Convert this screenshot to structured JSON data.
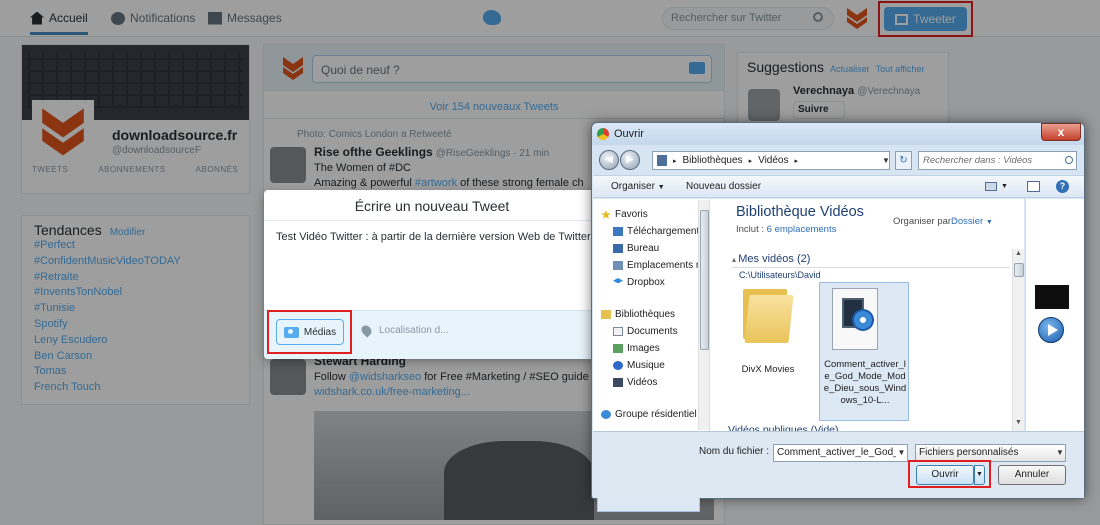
{
  "twitter": {
    "nav": {
      "home": "Accueil",
      "notifications": "Notifications",
      "messages": "Messages"
    },
    "search_placeholder": "Rechercher sur Twitter",
    "tweet_button": "Tweeter",
    "profile": {
      "name": "downloadsource.fr",
      "handle": "@downloadsourceF",
      "stats": [
        "TWEETS",
        "ABONNEMENTS",
        "ABONNÉS"
      ]
    },
    "trends": {
      "title": "Tendances",
      "edit": "Modifier",
      "items": [
        "#Perfect",
        "#ConfidentMusicVideoTODAY",
        "#Retraite",
        "#InventsTonNobel",
        "#Tunisie",
        "Spotify",
        "Leny Escudero",
        "Ben Carson",
        "Tomas",
        "French Touch"
      ]
    },
    "compose_placeholder": "Quoi de neuf ?",
    "new_tweets": "Voir 154 nouveaux Tweets",
    "retweet_line": "Photo: Comics London a Retweeté",
    "tweet1": {
      "name": "Rise ofthe Geeklings",
      "handle": "@RiseGeeklings · 21 min",
      "line1": "The Women of #DC",
      "line2_text": "Amazing & powerful ",
      "line2_link": "#artwork",
      "line2_rest": " of these strong female ch"
    },
    "tweet2": {
      "name": "Stewart Harding",
      "line1_text": "Follow ",
      "line1_link": "@widsharkseo",
      "line1_rest": " for Free #Marketing / #SEO guide",
      "line2": "widshark.co.uk/free-marketing..."
    },
    "suggestions": {
      "title": "Suggestions",
      "refresh": "Actualiser",
      "all": "Tout afficher",
      "name": "Verechnaya",
      "handle": "@Verechnaya",
      "follow": "Suivre"
    }
  },
  "tweet_modal": {
    "title": "Écrire un nouveau Tweet",
    "text": "Test Vidéo Twitter : à partir de la dernière version Web de Twitter",
    "media_button": "Médias",
    "location": "Localisation d..."
  },
  "open_dialog": {
    "title": "Ouvrir",
    "close_glyph": "x",
    "address": [
      "Bibliothèques",
      "Vidéos"
    ],
    "search_placeholder": "Rechercher dans : Vidéos",
    "toolbar": {
      "organize": "Organiser",
      "new_folder": "Nouveau dossier"
    },
    "nav_items": [
      {
        "label": "Favoris",
        "icon": "star-icon"
      },
      {
        "label": "Téléchargements",
        "icon": "downloads-icon"
      },
      {
        "label": "Bureau",
        "icon": "desktop-icon"
      },
      {
        "label": "Emplacements ré",
        "icon": "recent-places-icon"
      },
      {
        "label": "Dropbox",
        "icon": "dropbox-icon"
      },
      {
        "label": "Bibliothèques",
        "icon": "libraries-icon"
      },
      {
        "label": "Documents",
        "icon": "documents-icon"
      },
      {
        "label": "Images",
        "icon": "pictures-icon"
      },
      {
        "label": "Musique",
        "icon": "music-icon"
      },
      {
        "label": "Vidéos",
        "icon": "videos-icon"
      },
      {
        "label": "Groupe résidentiel",
        "icon": "homegroup-icon"
      }
    ],
    "library": {
      "title": "Bibliothèque Vidéos",
      "includes_label": "Inclut :",
      "includes_link": "6 emplacements",
      "organize_label": "Organiser par :",
      "organize_value": "Dossier",
      "group1": "Mes vidéos (2)",
      "group1_path": "C:\\Utilisateurs\\David",
      "folder_name": "DivX Movies",
      "file_name": "Comment_activer_le_God_Mode_Mode_Dieu_sous_Windows_10-L...",
      "group2": "Vidéos publiques (Vide)"
    },
    "filename_label": "Nom du fichier :",
    "filename_value": "Comment_activer_le_God_M",
    "filetype": "Fichiers personnalisés",
    "open_button": "Ouvrir",
    "cancel_button": "Annuler"
  }
}
